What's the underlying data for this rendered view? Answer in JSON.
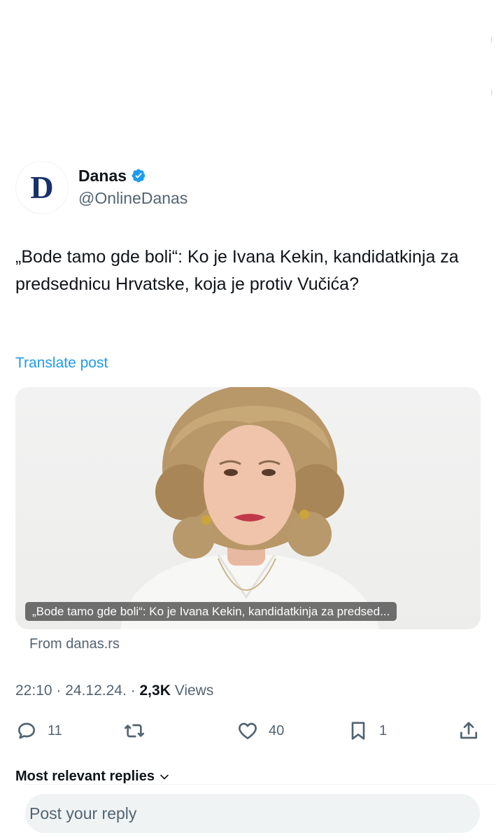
{
  "author": {
    "display_name": "Danas",
    "handle": "@OnlineDanas",
    "avatar_letter": "D",
    "verified": true
  },
  "post": {
    "text": "„Bode tamo gde boli“: Ko je Ivana Kekin, kandidatkinja za predsednicu Hrvatske, koja je protiv Vučića?",
    "translate_label": "Translate post"
  },
  "card": {
    "caption": "„Bode tamo gde boli“: Ko je Ivana Kekin, kandidatkinja za predsed...",
    "source": "From danas.rs"
  },
  "meta": {
    "time": "22:10",
    "date": "24.12.24.",
    "views_count": "2,3K",
    "views_label": "Views"
  },
  "actions": {
    "replies": "11",
    "reposts": "",
    "likes": "40",
    "bookmarks": "1"
  },
  "replies": {
    "sort_label": "Most relevant replies"
  },
  "reply_bar": {
    "placeholder": "Post your reply"
  },
  "colors": {
    "accent": "#1d9bf0",
    "text": "#0f1419",
    "secondary": "#536471"
  },
  "icons": [
    "verified-icon",
    "reply-icon",
    "repost-icon",
    "like-icon",
    "bookmark-icon",
    "share-icon",
    "chevron-down-icon"
  ]
}
